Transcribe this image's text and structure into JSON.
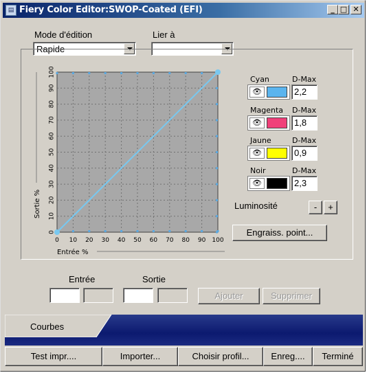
{
  "window": {
    "title": "Fiery Color Editor:SWOP-Coated (EFI)",
    "controls": {
      "minimize": "_",
      "maximize": "□",
      "close": "✕"
    }
  },
  "edit_mode": {
    "label": "Mode d'édition",
    "value": "Rapide"
  },
  "link_to": {
    "label": "Lier à",
    "value": ""
  },
  "chart_data": {
    "type": "line",
    "xlabel": "Entrée %",
    "ylabel": "Sortie %",
    "x_ticks": [
      "0",
      "10",
      "20",
      "30",
      "40",
      "50",
      "60",
      "70",
      "80",
      "90",
      "100"
    ],
    "y_ticks": [
      "0",
      "10",
      "20",
      "30",
      "40",
      "50",
      "60",
      "70",
      "80",
      "90",
      "100"
    ],
    "xlim": [
      0,
      100
    ],
    "ylim": [
      0,
      100
    ],
    "grid": true,
    "series": [
      {
        "x": [
          0,
          100
        ],
        "y": [
          0,
          100
        ],
        "color": "#78c8f0"
      }
    ]
  },
  "channels": [
    {
      "name": "Cyan",
      "dmax_label": "D-Max",
      "dmax": "2,2",
      "color": "#5ab4ee"
    },
    {
      "name": "Magenta",
      "dmax_label": "D-Max",
      "dmax": "1,8",
      "color": "#f0407a"
    },
    {
      "name": "Jaune",
      "dmax_label": "D-Max",
      "dmax": "0,9",
      "color": "#ffff00"
    },
    {
      "name": "Noir",
      "dmax_label": "D-Max",
      "dmax": "2,3",
      "color": "#000000"
    }
  ],
  "eye_glyph": "👁",
  "luminosity": {
    "label": "Luminosité",
    "minus": "-",
    "plus": "+"
  },
  "dot_gain_button": "Engraiss. point...",
  "entry": {
    "label": "Entrée"
  },
  "output": {
    "label": "Sortie"
  },
  "add_button": "Ajouter",
  "delete_button": "Supprimer",
  "tab": "Courbes",
  "bottom_buttons": [
    "Test impr....",
    "Importer...",
    "Choisir profil...",
    "Enreg....",
    "Terminé"
  ]
}
